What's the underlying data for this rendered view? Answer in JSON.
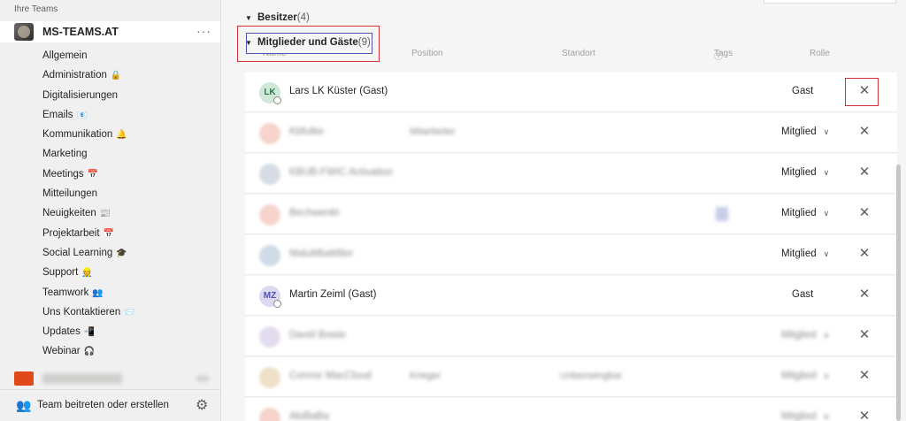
{
  "sidebar": {
    "header": "Ihre Teams",
    "team_name": "MS-TEAMS.AT",
    "more_label": "···",
    "channels": [
      {
        "label": "Allgemein",
        "icon": ""
      },
      {
        "label": "Administration",
        "icon": "🔒"
      },
      {
        "label": "Digitalisierungen",
        "icon": ""
      },
      {
        "label": "Emails",
        "icon": "📧"
      },
      {
        "label": "Kommunikation",
        "icon": "🔔"
      },
      {
        "label": "Marketing",
        "icon": ""
      },
      {
        "label": "Meetings",
        "icon": "📅"
      },
      {
        "label": "Mitteilungen",
        "icon": ""
      },
      {
        "label": "Neuigkeiten",
        "icon": "📰"
      },
      {
        "label": "Projektarbeit",
        "icon": "📅"
      },
      {
        "label": "Social Learning",
        "icon": "🎓"
      },
      {
        "label": "Support",
        "icon": "👷"
      },
      {
        "label": "Teamwork",
        "icon": "👥"
      },
      {
        "label": "Uns Kontaktieren",
        "icon": "📨"
      },
      {
        "label": "Updates",
        "icon": "📲"
      },
      {
        "label": "Webinar",
        "icon": "🎧"
      }
    ],
    "join_label": "Team beitreten oder erstellen"
  },
  "main": {
    "owners": {
      "label": "Besitzer",
      "count": "(4)"
    },
    "members": {
      "label": "Mitglieder und Gäste",
      "count": "(9)"
    },
    "columns": {
      "name": "Name",
      "position": "Position",
      "location": "Standort",
      "tags": "Tags",
      "role": "Rolle"
    },
    "rows": [
      {
        "initials": "LK",
        "name": "Lars LK Küster (Gast)",
        "position": "",
        "location": "",
        "role": "Gast",
        "avatar_bg": "#cfe8d8",
        "avatar_fg": "#237b4b",
        "guest": true,
        "blurred": false
      },
      {
        "initials": "",
        "name": "Kbfutke",
        "position": "Mitarbeiter",
        "location": "",
        "role": "Mitglied",
        "avatar_bg": "#f6d4cc",
        "avatar_fg": "#c4314b",
        "guest": false,
        "blurred": true
      },
      {
        "initials": "",
        "name": "KBUB-FWIC Activation",
        "position": "",
        "location": "",
        "role": "Mitglied",
        "avatar_bg": "#d6dbe4",
        "avatar_fg": "#5b6b84",
        "guest": false,
        "blurred": true
      },
      {
        "initials": "",
        "name": "Bechwenkt",
        "position": "",
        "location": "",
        "role": "Mitglied",
        "avatar_bg": "#f6d4cc",
        "avatar_fg": "#c4314b",
        "guest": false,
        "blurred": true,
        "tag": true
      },
      {
        "initials": "",
        "name": "MaluMbaMiler",
        "position": "",
        "location": "",
        "role": "Mitglied",
        "avatar_bg": "#cfdbe6",
        "avatar_fg": "#4a6a86",
        "guest": false,
        "blurred": true
      },
      {
        "initials": "MZ",
        "name": "Martin Zeiml (Gast)",
        "position": "",
        "location": "",
        "role": "Gast",
        "avatar_bg": "#dcd8ef",
        "avatar_fg": "#4f52b2",
        "guest": true,
        "blurred": false
      },
      {
        "initials": "",
        "name": "David Bowie",
        "position": "",
        "location": "",
        "role": "Mitglied",
        "avatar_bg": "#e3dcef",
        "avatar_fg": "#6b5aa6",
        "guest": false,
        "blurred": true,
        "role_blurred": true
      },
      {
        "initials": "",
        "name": "Connor MacCloud",
        "position": "Krieger",
        "location": "Unbezwingbar",
        "role": "Mitglied",
        "avatar_bg": "#efe0c8",
        "avatar_fg": "#a86a12",
        "guest": false,
        "blurred": true,
        "role_blurred": true
      },
      {
        "initials": "",
        "name": "AbiBaBa",
        "position": "",
        "location": "",
        "role": "Mitglied",
        "avatar_bg": "#f6d4cc",
        "avatar_fg": "#c4314b",
        "guest": false,
        "blurred": true,
        "role_blurred": true
      }
    ]
  }
}
